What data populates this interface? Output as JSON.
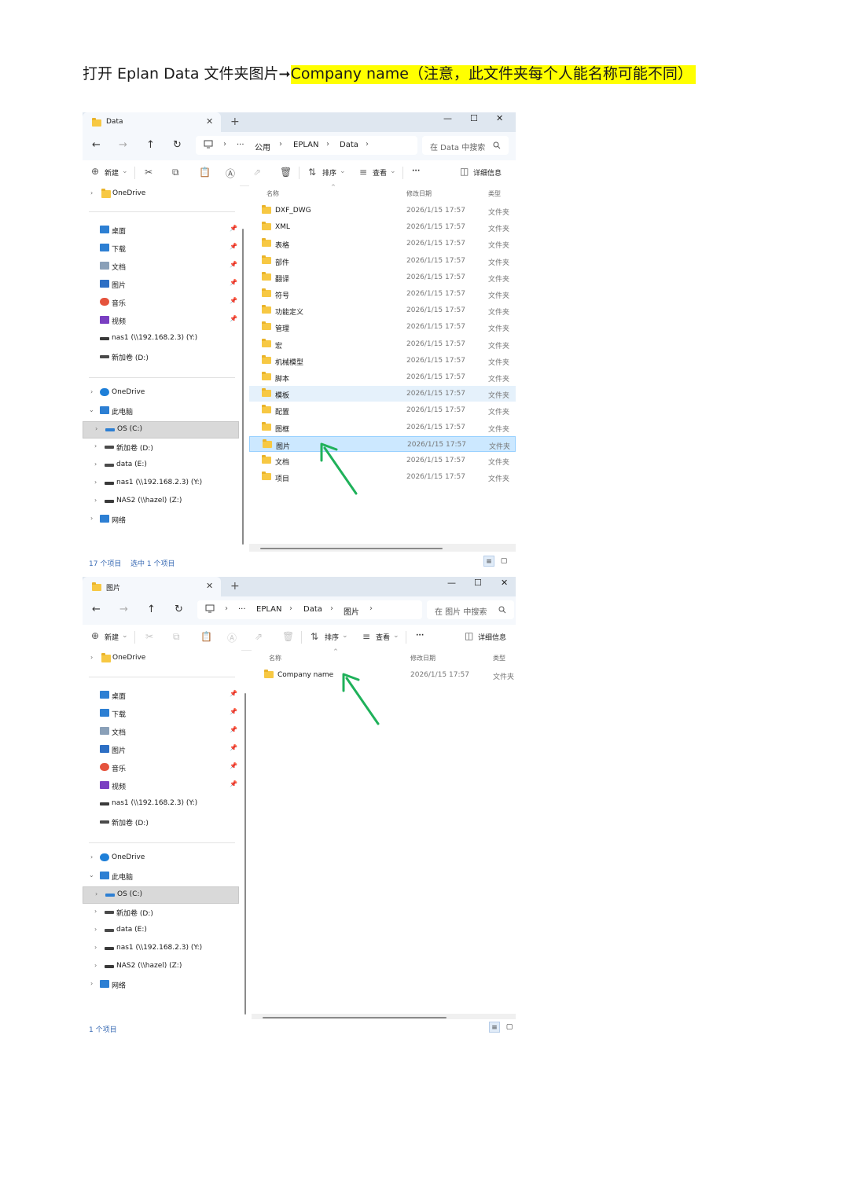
{
  "heading": {
    "prefix": "打开 Eplan Data 文件夹图片",
    "arrow": "➞",
    "highlight": "Company name（注意，此文件夹每个人能名称可能不同）"
  },
  "colors": {
    "highlight": "#ffff00",
    "arrow": "#1fb15a",
    "folder": "#f7c843",
    "selection": "#cce8ff"
  },
  "window1": {
    "tab_title": "Data",
    "tab_close": "✕",
    "new_tab": "+",
    "controls": [
      "—",
      "☐",
      "✕"
    ],
    "breadcrumb": [
      "···",
      "公用",
      "EPLAN",
      "Data"
    ],
    "search_placeholder": "在 Data 中搜索",
    "toolbar": {
      "new": "新建",
      "sort": "排序",
      "view": "查看",
      "more": "···",
      "details": "详细信息"
    },
    "sidebar": {
      "top": "OneDrive",
      "quick": [
        {
          "label": "桌面",
          "icon": "desktop-icon"
        },
        {
          "label": "下载",
          "icon": "download-icon"
        },
        {
          "label": "文档",
          "icon": "document-icon"
        },
        {
          "label": "图片",
          "icon": "picture-icon"
        },
        {
          "label": "音乐",
          "icon": "music-icon"
        },
        {
          "label": "视频",
          "icon": "video-icon"
        },
        {
          "label": "nas1 (\\\\192.168.2.3) (Y:)",
          "icon": "network-drive-icon"
        },
        {
          "label": "新加卷 (D:)",
          "icon": "drive-icon"
        }
      ],
      "tree": [
        {
          "label": "OneDrive",
          "icon": "cloud-icon"
        },
        {
          "label": "此电脑",
          "icon": "pc-icon"
        },
        {
          "label": "OS (C:)",
          "icon": "os-drive-icon"
        },
        {
          "label": "新加卷 (D:)",
          "icon": "drive-icon"
        },
        {
          "label": "data (E:)",
          "icon": "drive-icon"
        },
        {
          "label": "nas1 (\\\\192.168.2.3) (Y:)",
          "icon": "network-drive-icon"
        },
        {
          "label": "NAS2 (\\\\hazel) (Z:)",
          "icon": "network-drive-icon"
        },
        {
          "label": "网络",
          "icon": "network-icon"
        }
      ]
    },
    "columns": {
      "name": "名称",
      "date": "修改日期",
      "type": "类型"
    },
    "rows": [
      {
        "name": "DXF_DWG",
        "date": "2026/1/15 17:57",
        "type": "文件夹"
      },
      {
        "name": "XML",
        "date": "2026/1/15 17:57",
        "type": "文件夹"
      },
      {
        "name": "表格",
        "date": "2026/1/15 17:57",
        "type": "文件夹"
      },
      {
        "name": "部件",
        "date": "2026/1/15 17:57",
        "type": "文件夹"
      },
      {
        "name": "翻译",
        "date": "2026/1/15 17:57",
        "type": "文件夹"
      },
      {
        "name": "符号",
        "date": "2026/1/15 17:57",
        "type": "文件夹"
      },
      {
        "name": "功能定义",
        "date": "2026/1/15 17:57",
        "type": "文件夹"
      },
      {
        "name": "管理",
        "date": "2026/1/15 17:57",
        "type": "文件夹"
      },
      {
        "name": "宏",
        "date": "2026/1/15 17:57",
        "type": "文件夹"
      },
      {
        "name": "机械模型",
        "date": "2026/1/15 17:57",
        "type": "文件夹"
      },
      {
        "name": "脚本",
        "date": "2026/1/15 17:57",
        "type": "文件夹"
      },
      {
        "name": "模板",
        "date": "2026/1/15 17:57",
        "type": "文件夹"
      },
      {
        "name": "配置",
        "date": "2026/1/15 17:57",
        "type": "文件夹"
      },
      {
        "name": "图框",
        "date": "2026/1/15 17:57",
        "type": "文件夹"
      },
      {
        "name": "图片",
        "date": "2026/1/15 17:57",
        "type": "文件夹"
      },
      {
        "name": "文档",
        "date": "2026/1/15 17:57",
        "type": "文件夹"
      },
      {
        "name": "项目",
        "date": "2026/1/15 17:57",
        "type": "文件夹"
      }
    ],
    "status_count": "17 个项目",
    "status_selected": "选中 1 个项目"
  },
  "window2": {
    "tab_title": "图片",
    "tab_close": "✕",
    "new_tab": "+",
    "controls": [
      "—",
      "☐",
      "✕"
    ],
    "breadcrumb": [
      "···",
      "EPLAN",
      "Data",
      "图片"
    ],
    "search_placeholder": "在 图片 中搜索",
    "toolbar": {
      "new": "新建",
      "sort": "排序",
      "view": "查看",
      "more": "···",
      "details": "详细信息"
    },
    "columns": {
      "name": "名称",
      "date": "修改日期",
      "type": "类型"
    },
    "rows": [
      {
        "name": "Company name",
        "date": "2026/1/15 17:57",
        "type": "文件夹"
      }
    ],
    "status_count": "1 个项目"
  }
}
